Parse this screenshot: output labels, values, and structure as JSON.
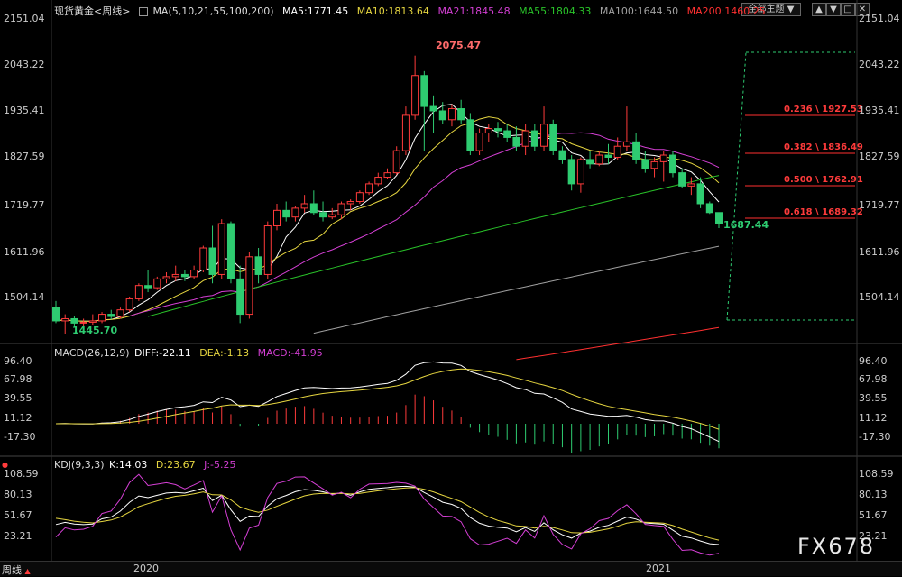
{
  "toolbar": {
    "menu_label": "全部主题",
    "buttons": [
      "▲",
      "▼",
      "□",
      "✕"
    ]
  },
  "main_legend": {
    "symbol": "现货黄金<周线>",
    "ma_label": "MA(5,10,21,55,100,200)",
    "ma5": "MA5:1771.45",
    "ma10": "MA10:1813.64",
    "ma21": "MA21:1845.48",
    "ma55": "MA55:1804.33",
    "ma100": "MA100:1644.50",
    "ma200": "MA200:1460.25"
  },
  "main_axis": [
    "2151.04",
    "2043.22",
    "1935.41",
    "1827.59",
    "1719.77",
    "1611.96",
    "1504.14"
  ],
  "annotations": {
    "high": "2075.47",
    "low": "1445.70",
    "last": "1687.44"
  },
  "fibonacci": [
    {
      "label": "0.236 \\ 1927.53"
    },
    {
      "label": "0.382 \\ 1836.49"
    },
    {
      "label": "0.500 \\ 1762.91"
    },
    {
      "label": "0.618 \\ 1689.32"
    }
  ],
  "macd_legend": {
    "label": "MACD(26,12,9)",
    "diff": "DIFF:-22.11",
    "dea": "DEA:-1.13",
    "macd": "MACD:-41.95"
  },
  "macd_axis": [
    "96.40",
    "67.98",
    "39.55",
    "11.12",
    "-17.30"
  ],
  "kdj_legend": {
    "label": "KDJ(9,3,3)",
    "k": "K:14.03",
    "d": "D:23.67",
    "j": "J:-5.25"
  },
  "kdj_axis": [
    "108.59",
    "80.13",
    "51.67",
    "23.21"
  ],
  "time_axis": {
    "period": "周线",
    "year1": "2020",
    "year2": "2021"
  },
  "watermark": "FX678",
  "colors": {
    "up": "#ff3b3b",
    "down": "#2ecc71",
    "ma5": "#ffffff",
    "ma10": "#e6d640",
    "ma21": "#d43fd4",
    "ma55": "#29c229",
    "ma100": "#a0a0a0",
    "ma200": "#ff3030"
  },
  "chart_data": {
    "type": "candlestick",
    "period": "weekly",
    "ylim": [
      1430,
      2160
    ],
    "candles": [
      [
        1505,
        1520,
        1470,
        1475
      ],
      [
        1475,
        1490,
        1446,
        1480
      ],
      [
        1480,
        1485,
        1460,
        1470
      ],
      [
        1470,
        1480,
        1455,
        1472
      ],
      [
        1472,
        1490,
        1465,
        1475
      ],
      [
        1475,
        1495,
        1470,
        1490
      ],
      [
        1490,
        1500,
        1478,
        1485
      ],
      [
        1485,
        1505,
        1480,
        1500
      ],
      [
        1500,
        1530,
        1495,
        1525
      ],
      [
        1525,
        1560,
        1520,
        1555
      ],
      [
        1555,
        1590,
        1540,
        1550
      ],
      [
        1550,
        1575,
        1545,
        1570
      ],
      [
        1570,
        1585,
        1560,
        1575
      ],
      [
        1575,
        1600,
        1565,
        1580
      ],
      [
        1580,
        1590,
        1565,
        1575
      ],
      [
        1575,
        1600,
        1570,
        1590
      ],
      [
        1590,
        1645,
        1585,
        1640
      ],
      [
        1640,
        1690,
        1560,
        1580
      ],
      [
        1580,
        1705,
        1570,
        1695
      ],
      [
        1695,
        1700,
        1560,
        1570
      ],
      [
        1570,
        1600,
        1470,
        1490
      ],
      [
        1490,
        1630,
        1480,
        1620
      ],
      [
        1620,
        1640,
        1560,
        1580
      ],
      [
        1580,
        1700,
        1570,
        1690
      ],
      [
        1690,
        1740,
        1680,
        1725
      ],
      [
        1725,
        1745,
        1700,
        1710
      ],
      [
        1710,
        1735,
        1700,
        1730
      ],
      [
        1730,
        1760,
        1720,
        1740
      ],
      [
        1740,
        1770,
        1715,
        1720
      ],
      [
        1720,
        1745,
        1700,
        1710
      ],
      [
        1710,
        1730,
        1705,
        1715
      ],
      [
        1715,
        1745,
        1705,
        1740
      ],
      [
        1740,
        1750,
        1725,
        1745
      ],
      [
        1745,
        1770,
        1740,
        1765
      ],
      [
        1765,
        1790,
        1760,
        1785
      ],
      [
        1785,
        1810,
        1780,
        1800
      ],
      [
        1800,
        1820,
        1795,
        1810
      ],
      [
        1810,
        1870,
        1805,
        1860
      ],
      [
        1860,
        1960,
        1850,
        1940
      ],
      [
        1940,
        2075,
        1930,
        2030
      ],
      [
        2030,
        2040,
        1860,
        1960
      ],
      [
        1960,
        1985,
        1900,
        1950
      ],
      [
        1950,
        1970,
        1920,
        1930
      ],
      [
        1930,
        1965,
        1915,
        1955
      ],
      [
        1955,
        1975,
        1920,
        1930
      ],
      [
        1930,
        1945,
        1850,
        1860
      ],
      [
        1860,
        1910,
        1850,
        1900
      ],
      [
        1900,
        1920,
        1880,
        1910
      ],
      [
        1910,
        1925,
        1890,
        1905
      ],
      [
        1905,
        1920,
        1880,
        1890
      ],
      [
        1890,
        1915,
        1860,
        1870
      ],
      [
        1870,
        1920,
        1850,
        1905
      ],
      [
        1905,
        1920,
        1860,
        1870
      ],
      [
        1870,
        1960,
        1860,
        1920
      ],
      [
        1920,
        1930,
        1850,
        1860
      ],
      [
        1860,
        1870,
        1830,
        1840
      ],
      [
        1840,
        1850,
        1770,
        1785
      ],
      [
        1785,
        1845,
        1765,
        1840
      ],
      [
        1840,
        1860,
        1820,
        1830
      ],
      [
        1830,
        1860,
        1825,
        1850
      ],
      [
        1850,
        1875,
        1830,
        1845
      ],
      [
        1845,
        1890,
        1840,
        1870
      ],
      [
        1870,
        1960,
        1860,
        1880
      ],
      [
        1880,
        1900,
        1830,
        1840
      ],
      [
        1840,
        1860,
        1810,
        1820
      ],
      [
        1820,
        1845,
        1800,
        1835
      ],
      [
        1835,
        1860,
        1790,
        1850
      ],
      [
        1850,
        1860,
        1800,
        1810
      ],
      [
        1810,
        1820,
        1775,
        1780
      ],
      [
        1780,
        1800,
        1760,
        1785
      ],
      [
        1785,
        1800,
        1730,
        1740
      ],
      [
        1740,
        1745,
        1717,
        1720
      ],
      [
        1720,
        1720,
        1685,
        1695
      ]
    ]
  }
}
